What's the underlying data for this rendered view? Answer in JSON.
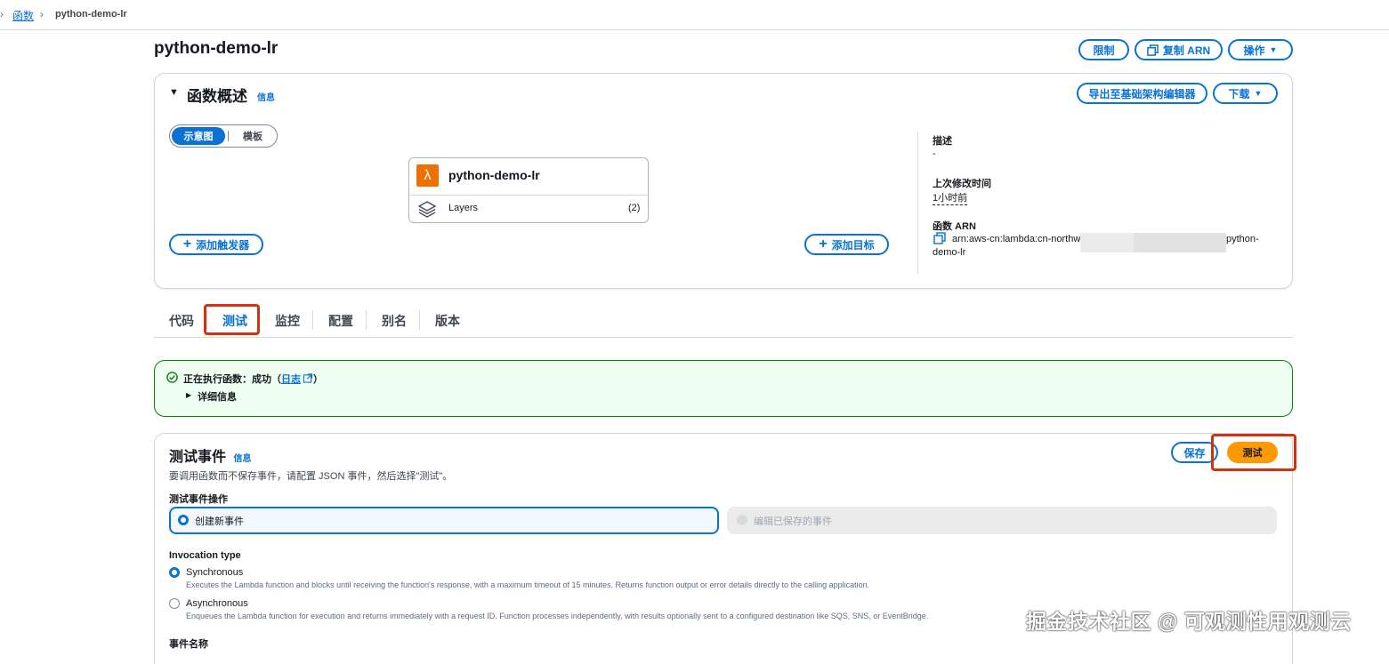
{
  "breadcrumb": {
    "root": "函数",
    "current": "python-demo-lr"
  },
  "header": {
    "title": "python-demo-lr",
    "limit_label": "限制",
    "copy_arn_label": "复制 ARN",
    "actions_label": "操作"
  },
  "overview": {
    "title": "函数概述",
    "info_label": "信息",
    "export_label": "导出至基础架构编辑器",
    "download_label": "下载",
    "view_toggle": {
      "diagram": "示意图",
      "template": "模板"
    },
    "function_card": {
      "name": "python-demo-lr",
      "layers_label": "Layers",
      "layers_count": "(2)"
    },
    "add_trigger_label": "添加触发器",
    "add_destination_label": "添加目标",
    "description_label": "描述",
    "description_value": "-",
    "last_modified_label": "上次修改时间",
    "last_modified_value": "1小时前",
    "arn_label": "函数 ARN",
    "arn_prefix": "arn:aws-cn:lambda:cn-northw",
    "arn_suffix": "python-",
    "arn_tail": "demo-lr"
  },
  "tabs": [
    {
      "label": "代码"
    },
    {
      "label": "测试"
    },
    {
      "label": "监控"
    },
    {
      "label": "配置"
    },
    {
      "label": "别名"
    },
    {
      "label": "版本"
    }
  ],
  "alert": {
    "prefix": "正在执行函数：成功（",
    "log_link": "日志",
    "suffix": "）",
    "details_label": "详细信息"
  },
  "test_event": {
    "title": "测试事件",
    "info_label": "信息",
    "description": "要调用函数而不保存事件，请配置 JSON 事件，然后选择\"测试\"。",
    "save_label": "保存",
    "test_label": "测试",
    "action_label": "测试事件操作",
    "create_new_label": "创建新事件",
    "edit_saved_label": "编辑已保存的事件",
    "invocation_type_label": "Invocation type",
    "sync_label": "Synchronous",
    "sync_desc": "Executes the Lambda function and blocks until receiving the function's response, with a maximum timeout of 15 minutes. Returns function output or error details directly to the calling application.",
    "async_label": "Asynchronous",
    "async_desc": "Enqueues the Lambda function for execution and returns immediately with a request ID. Function processes independently, with results optionally sent to a configured destination like SQS, SNS, or EventBridge.",
    "event_name_label": "事件名称"
  },
  "watermark": "掘金技术社区 @ 可观测性用观测云",
  "colors": {
    "accent": "#0972d3",
    "primary_button": "#ff9900",
    "success_border": "#037f0c",
    "success_bg": "#effff1",
    "highlight_box": "#d13212",
    "lambda_icon": "#ed7100"
  }
}
